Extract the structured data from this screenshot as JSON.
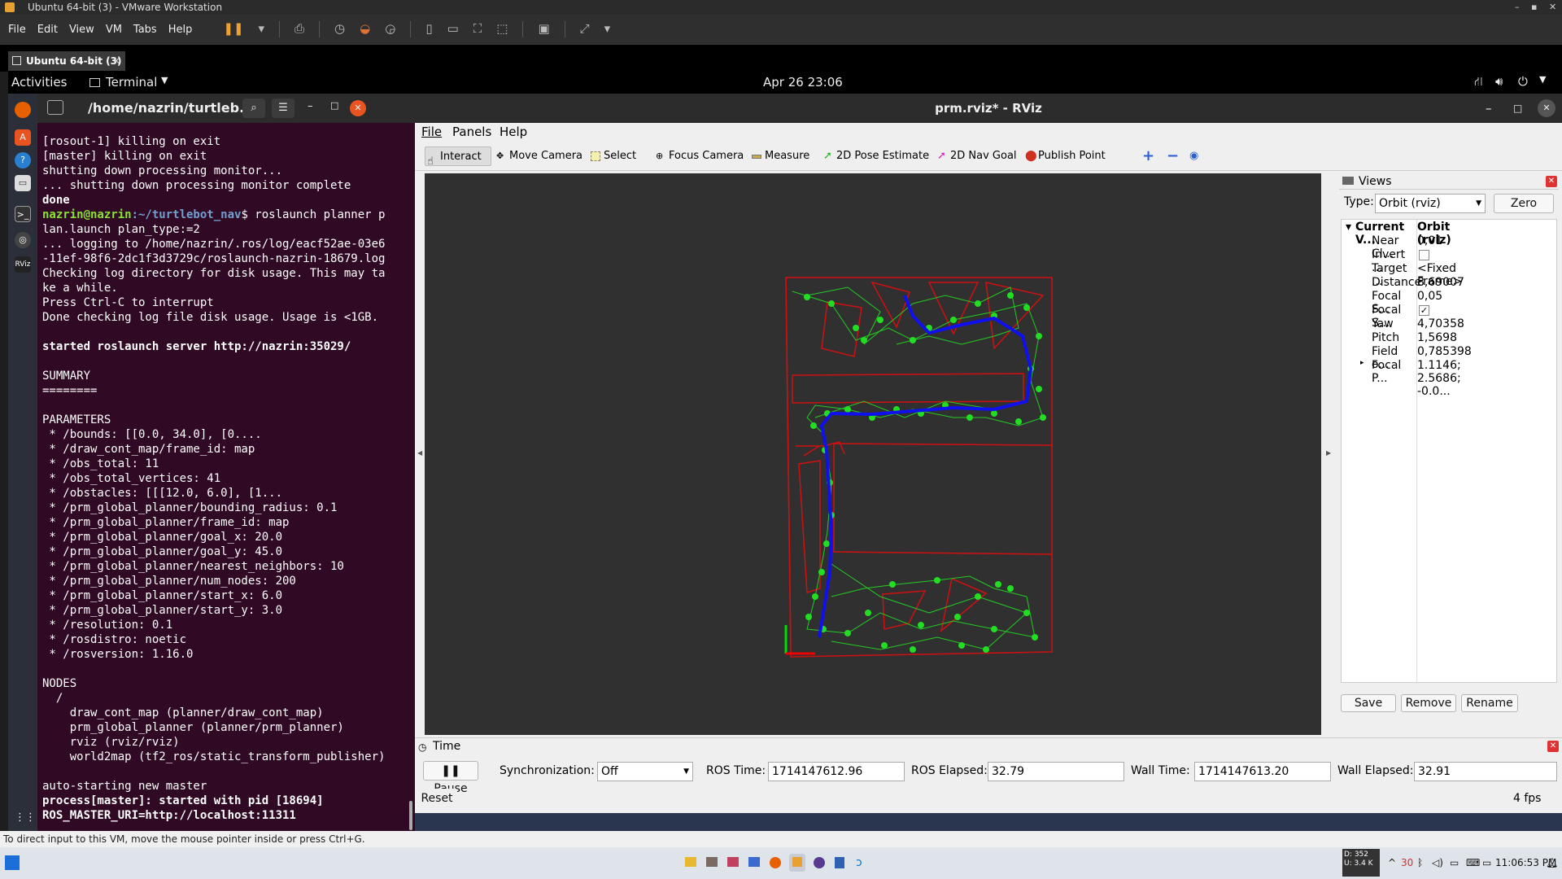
{
  "vmware": {
    "title": "Ubuntu 64-bit (3) - VMware Workstation",
    "menu": [
      "File",
      "Edit",
      "View",
      "VM",
      "Tabs",
      "Help"
    ],
    "tab_label": "Ubuntu 64-bit (3)"
  },
  "gnome": {
    "activities": "Activities",
    "app": "Terminal",
    "datetime": "Apr 26  23:06"
  },
  "terminal": {
    "title": "/home/nazrin/turtleb...",
    "lines": [
      "[rosout-1] killing on exit",
      "[master] killing on exit",
      "shutting down processing monitor...",
      "... shutting down processing monitor complete",
      "done",
      "PROMPT",
      "lan.launch plan_type:=2",
      "... logging to /home/nazrin/.ros/log/eacf52ae-03e6",
      "-11ef-98f6-2dc1f3d3729c/roslaunch-nazrin-18679.log",
      "Checking log directory for disk usage. This may ta",
      "ke a while.",
      "Press Ctrl-C to interrupt",
      "Done checking log file disk usage. Usage is <1GB.",
      "",
      "started roslaunch server http://nazrin:35029/",
      "",
      "SUMMARY",
      "========",
      "",
      "PARAMETERS",
      " * /bounds: [[0.0, 34.0], [0....",
      " * /draw_cont_map/frame_id: map",
      " * /obs_total: 11",
      " * /obs_total_vertices: 41",
      " * /obstacles: [[[12.0, 6.0], [1...",
      " * /prm_global_planner/bounding_radius: 0.1",
      " * /prm_global_planner/frame_id: map",
      " * /prm_global_planner/goal_x: 20.0",
      " * /prm_global_planner/goal_y: 45.0",
      " * /prm_global_planner/nearest_neighbors: 10",
      " * /prm_global_planner/num_nodes: 200",
      " * /prm_global_planner/start_x: 6.0",
      " * /prm_global_planner/start_y: 3.0",
      " * /resolution: 0.1",
      " * /rosdistro: noetic",
      " * /rosversion: 1.16.0",
      "",
      "NODES",
      "  /",
      "    draw_cont_map (planner/draw_cont_map)",
      "    prm_global_planner (planner/prm_planner)",
      "    rviz (rviz/rviz)",
      "    world2map (tf2_ros/static_transform_publisher)",
      "",
      "auto-starting new master",
      "process[master]: started with pid [18694]",
      "ROS_MASTER_URI=http://localhost:11311"
    ],
    "bold_lines": [
      4,
      14,
      45,
      46
    ],
    "prompt_user": "nazrin@nazrin",
    "prompt_path": ":~/turtlebot_nav",
    "prompt_cmd": "$ roslaunch planner p"
  },
  "rviz": {
    "title": "prm.rviz* - RViz",
    "menu": [
      "File",
      "Panels",
      "Help"
    ],
    "tools": [
      "Interact",
      "Move Camera",
      "Select",
      "Focus Camera",
      "Measure",
      "2D Pose Estimate",
      "2D Nav Goal",
      "Publish Point"
    ],
    "views": {
      "header": "Views",
      "type_label": "Type:",
      "type_value": "Orbit (rviz)",
      "zero": "Zero",
      "tree_key": "Current V...",
      "tree_val": "Orbit (rviz)",
      "props": [
        {
          "k": "Near Cl...",
          "v": "0,01"
        },
        {
          "k": "Invert ...",
          "v": ""
        },
        {
          "k": "Target ...",
          "v": "<Fixed Frame>"
        },
        {
          "k": "Distance",
          "v": "8,69007"
        },
        {
          "k": "Focal S...",
          "v": "0,05"
        },
        {
          "k": "Focal S...",
          "v": ""
        },
        {
          "k": "Yaw",
          "v": "4,70358"
        },
        {
          "k": "Pitch",
          "v": "1,5698"
        },
        {
          "k": "Field o...",
          "v": "0,785398"
        },
        {
          "k": "Focal P...",
          "v": "1.1146; 2.5686; -0.0..."
        }
      ],
      "invert_checked": false,
      "focal_shape_checked": true,
      "save": "Save",
      "remove": "Remove",
      "rename": "Rename"
    },
    "time": {
      "header": "Time",
      "pause": "Pause",
      "sync_label": "Synchronization:",
      "sync_value": "Off",
      "ros_time_label": "ROS Time:",
      "ros_time": "1714147612.96",
      "ros_elapsed_label": "ROS Elapsed:",
      "ros_elapsed": "32.79",
      "wall_time_label": "Wall Time:",
      "wall_time": "1714147613.20",
      "wall_elapsed_label": "Wall Elapsed:",
      "wall_elapsed": "32.91",
      "reset": "Reset",
      "fps": "4 fps"
    }
  },
  "vm_status": "To direct input to this VM, move the mouse pointer inside or press Ctrl+G.",
  "taskbar": {
    "clock": "11:06:53 PM",
    "net_down": "D: 352",
    "net_up": "U: 3.4 K",
    "temp": "30"
  },
  "colors": {
    "terminal_bg": "#300a24",
    "obstacle": "#d01010",
    "nodes": "#22dd22",
    "path": "#1010ee"
  }
}
